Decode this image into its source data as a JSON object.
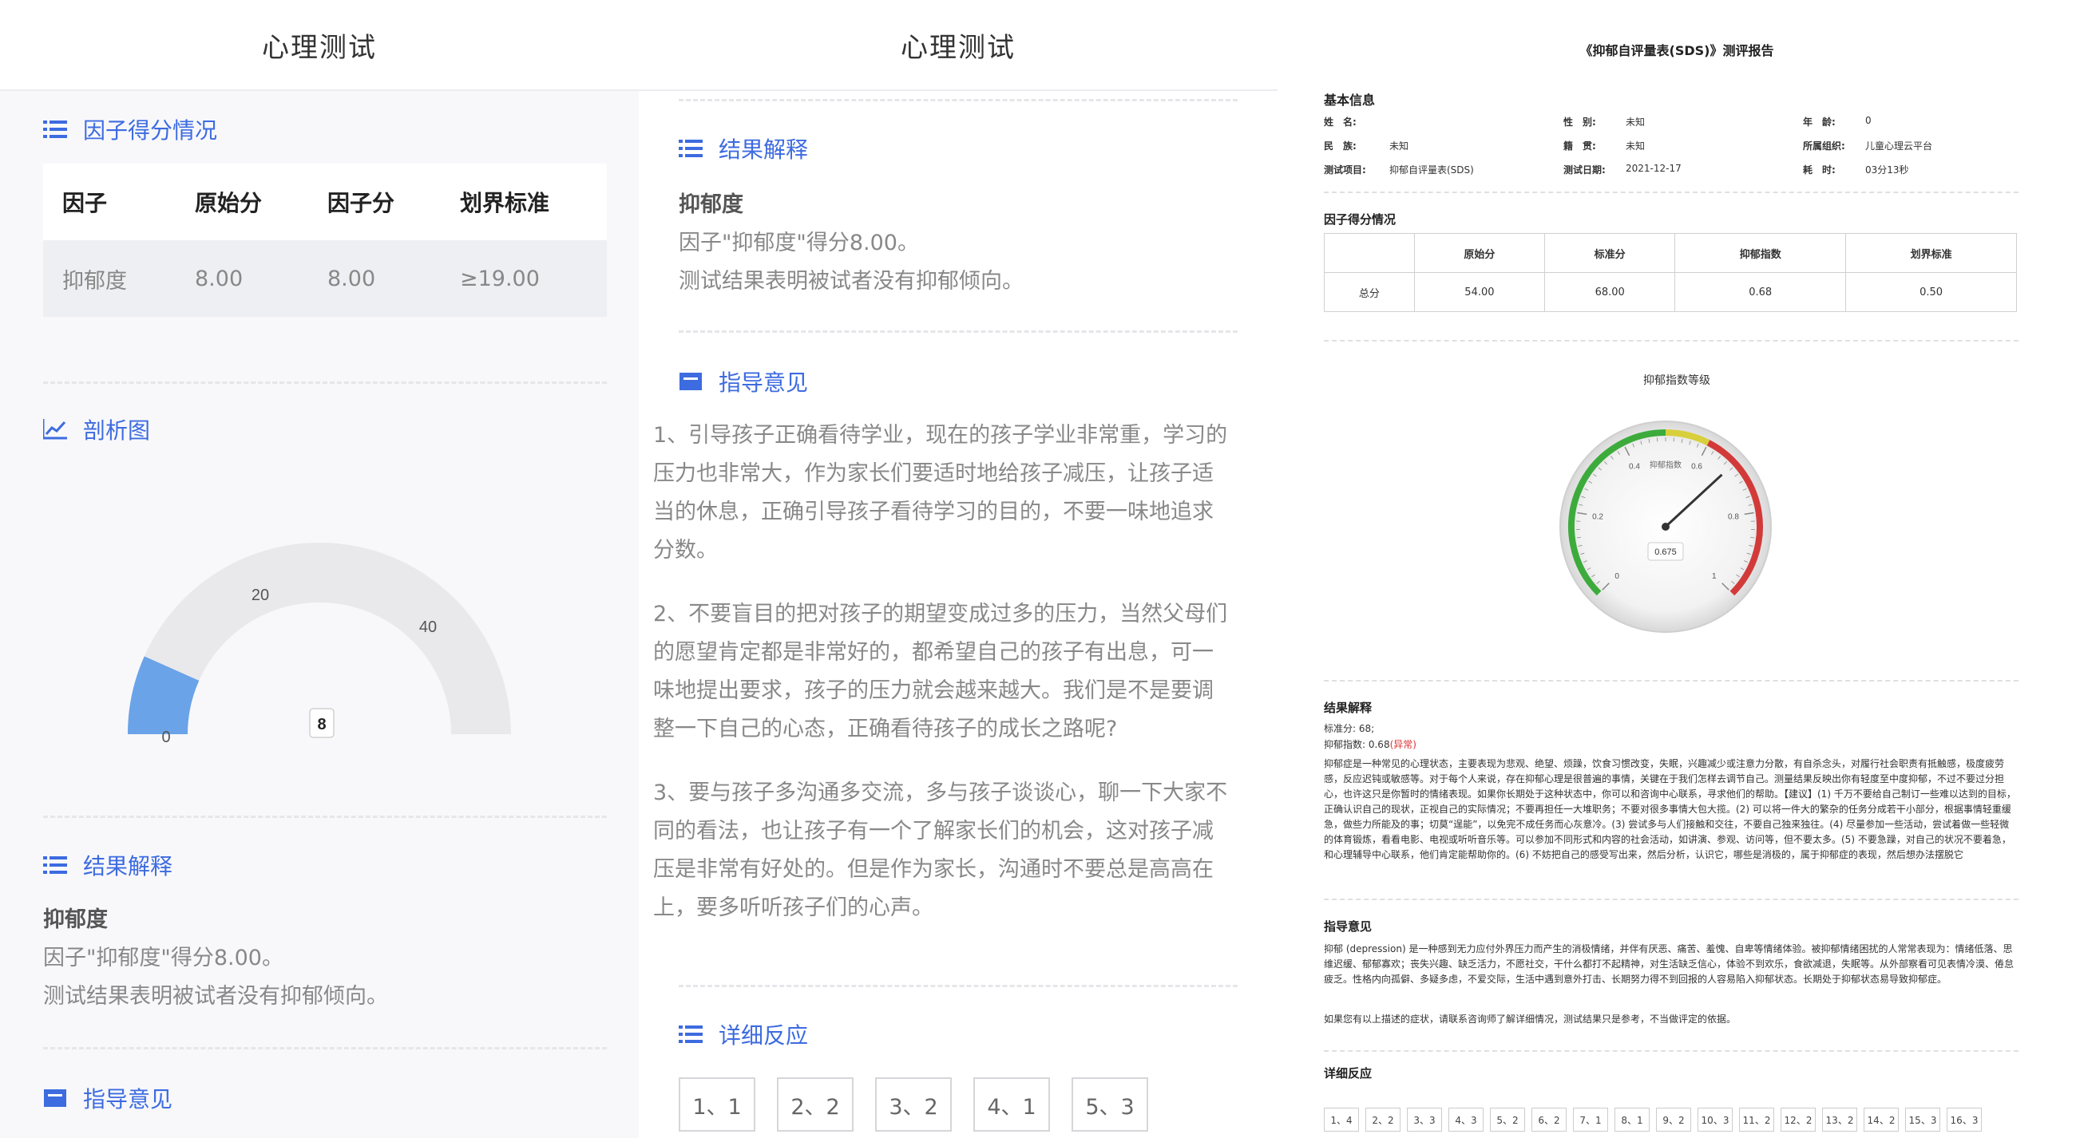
{
  "panel1": {
    "title": "心理测试",
    "factor_section": "因子得分情况",
    "table_headers": [
      "因子",
      "原始分",
      "因子分",
      "划界标准"
    ],
    "table_row": [
      "抑郁度",
      "8.00",
      "8.00",
      "≥19.00"
    ],
    "chart_section": "剖析图",
    "gauge": {
      "min_label": "0",
      "tick_20": "20",
      "tick_40": "40",
      "value_label": "8",
      "value": 8,
      "max": 60,
      "fill_color": "#6aa3e8"
    },
    "result_section": "结果解释",
    "result_factor": "抑郁度",
    "result_line1": "因子\"抑郁度\"得分8.00。",
    "result_line2": "测试结果表明被试者没有抑郁倾向。",
    "advice_section": "指导意见"
  },
  "panel2": {
    "title": "心理测试",
    "result_section": "结果解释",
    "result_factor": "抑郁度",
    "result_line1": "因子\"抑郁度\"得分8.00。",
    "result_line2": "测试结果表明被试者没有抑郁倾向。",
    "advice_section": "指导意见",
    "advice_lines": [
      "1、引导孩子正确看待学业，现在的孩子学业非常重，学习的",
      "压力也非常大，作为家长们要适时地给孩子减压，让孩子适",
      "当的休息，正确引导孩子看待学习的目的，不要一味地追求",
      "分数。",
      "2、不要盲目的把对孩子的期望变成过多的压力，当然父母们",
      "的愿望肯定都是非常好的，都希望自己的孩子有出息，可一",
      "味地提出要求，孩子的压力就会越来越大。我们是不是要调",
      "整一下自己的心态，正确看待孩子的成长之路呢?",
      "3、要与孩子多沟通多交流，多与孩子谈谈心，聊一下大家不",
      "同的看法，也让孩子有一个了解家长们的机会，这对孩子减",
      "压是非常有好处的。但是作为家长，沟通时不要总是高高在",
      "上，要多听听孩子们的心声。"
    ],
    "detail_section": "详细反应",
    "answers": [
      "1、1",
      "2、2",
      "3、2",
      "4、1",
      "5、3"
    ]
  },
  "report": {
    "title": "《抑郁自评量表(SDS)》测评报告",
    "basic_info": "基本信息",
    "info": [
      [
        "姓　名:",
        "",
        "性　别:",
        "未知",
        "年　龄:",
        "0"
      ],
      [
        "民　族:",
        "未知",
        "籍　贯:",
        "未知",
        "所属组织:",
        "儿童心理云平台"
      ],
      [
        "测试项目:",
        "抑郁自评量表(SDS)",
        "测试日期:",
        "2021-12-17",
        "耗　时:",
        "03分13秒"
      ]
    ],
    "factor_title": "因子得分情况",
    "table_headers": [
      "",
      "原始分",
      "标准分",
      "抑郁指数",
      "划界标准"
    ],
    "table_row": [
      "总分",
      "54.00",
      "68.00",
      "0.68",
      "0.50"
    ],
    "gauge_title": "抑郁指数等级",
    "gauge": {
      "inner_label": "抑郁指数",
      "readout": "0.675",
      "value": 0.675,
      "ticks": [
        "0",
        "0.2",
        "0.4",
        "0.6",
        "0.8",
        "1"
      ]
    },
    "result_title": "结果解释",
    "std_score": "标准分: 68;",
    "index_prefix": "抑郁指数: 0.68",
    "index_flag": "(异常)",
    "result_para": "抑郁症是一种常见的心理状态，主要表现为悲观、绝望、烦躁，饮食习惯改变，失眠，兴趣减少或注意力分散，有自杀念头，对履行社会职责有抵触感，极度疲劳感，反应迟钝或敏感等。对于每个人来说，存在抑郁心理是很普遍的事情，关键在于我们怎样去调节自己。测量结果反映出你有轻度至中度抑郁，不过不要过分担心，也许这只是你暂时的情绪表现。如果你长期处于这种状态中，你可以和咨询中心联系，寻求他们的帮助。【建议】(1) 千万不要给自己制订一些难以达到的目标，正确认识自己的现状，正视自己的实际情况；不要再担任一大堆职务；不要对很多事情大包大揽。(2) 可以将一件大的繁杂的任务分成若干小部分，根据事情轻重缓急，做些力所能及的事；切莫“逞能”，以免完不成任务而心灰意冷。(3) 尝试多与人们接触和交往，不要自己独来独往。(4) 尽量参加一些活动，尝试着做一些轻微的体育锻炼，看看电影、电视或听听音乐等。可以参加不同形式和内容的社会活动，如讲演、参观、访问等，但不要太多。(5) 不要急躁，对自己的状况不要着急，和心理辅导中心联系，他们肯定能帮助你的。(6) 不妨把自己的感受写出来，然后分析，认识它，哪些是消极的，属于抑郁症的表现，然后想办法摆脱它",
    "advice_title": "指导意见",
    "advice_para": "抑郁 (depression) 是一种感到无力应付外界压力而产生的消极情绪，并伴有厌恶、痛苦、羞愧、自卑等情绪体验。被抑郁情绪困扰的人常常表现为：情绪低落、思维迟缓、郁郁寡欢；丧失兴趣、缺乏活力，不愿社交，干什么都打不起精神，对生活缺乏信心，体验不到欢乐，食欲减退，失眠等。从外部察看可见表情冷漠、倦怠疲乏。性格内向孤僻、多疑多虑，不爱交际，生活中遇到意外打击、长期努力得不到回报的人容易陷入抑郁状态。长期处于抑郁状态易导致抑郁症。",
    "advice_note": "如果您有以上描述的症状，请联系咨询师了解详细情况，测试结果只是参考，不当做评定的依据。",
    "detail_title": "详细反应",
    "answers": [
      "1、4",
      "2、2",
      "3、3",
      "4、3",
      "5、2",
      "6、2",
      "7、1",
      "8、1",
      "9、2",
      "10、3",
      "11、2",
      "12、2",
      "13、2",
      "14、2",
      "15、3",
      "16、3"
    ]
  }
}
